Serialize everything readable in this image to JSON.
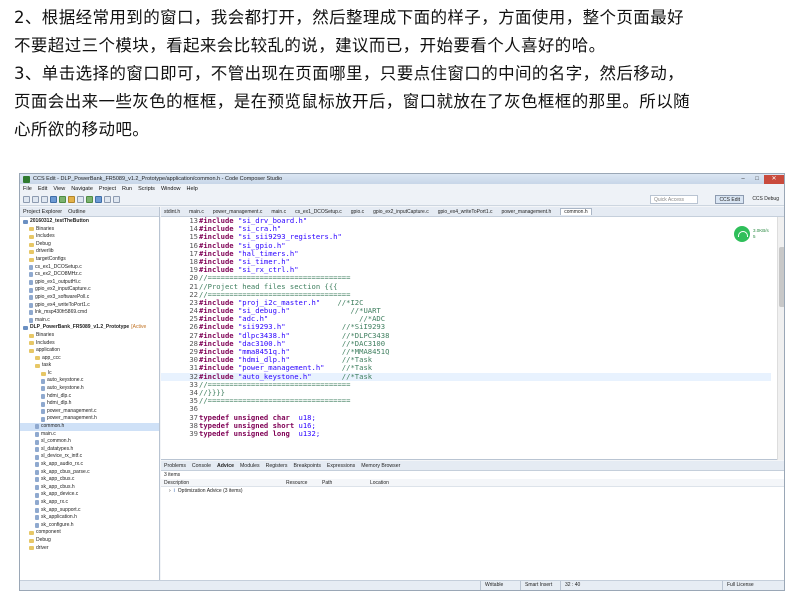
{
  "article": {
    "p1_line1": "2、根据经常用到的窗口，我会都打开，然后整理成下面的样子，方面使用，整个页面最好",
    "p1_line2": "不要超过三个模块，看起来会比较乱的说，建议而已，开始要看个人喜好的哈。",
    "p2_line1": "3、单击选择的窗口即可，不管出现在页面哪里，只要点住窗口的中间的名字，然后移动，",
    "p2_line2": "页面会出来一些灰色的框框，是在预览鼠标放开后，窗口就放在了灰色框框的那里。所以随",
    "p2_line3": "心所欲的移动吧。"
  },
  "ide": {
    "title": "CCS Edit - DLP_PowerBank_FR5089_v1.2_Prototype/application/common.h - Code Composer Studio",
    "menu": [
      "File",
      "Edit",
      "View",
      "Navigate",
      "Project",
      "Run",
      "Scripts",
      "Window",
      "Help"
    ],
    "quick_access": "Quick Access",
    "perspective_active": "CCS Edit",
    "perspective_other": "CCS Debug",
    "left_tabs": [
      "Project Explorer",
      "Outline"
    ],
    "tree": [
      {
        "indent": 0,
        "icon": "proj",
        "label": "20160312_testTheButton"
      },
      {
        "indent": 1,
        "icon": "folder",
        "label": "Binaries"
      },
      {
        "indent": 1,
        "icon": "folder",
        "label": "Includes"
      },
      {
        "indent": 1,
        "icon": "folder",
        "label": "Debug"
      },
      {
        "indent": 1,
        "icon": "folder",
        "label": "driverlib"
      },
      {
        "indent": 1,
        "icon": "folder",
        "label": "targetConfigs"
      },
      {
        "indent": 1,
        "icon": "file",
        "label": "cs_ex1_DCOSetup.c"
      },
      {
        "indent": 1,
        "icon": "file",
        "label": "cs_ex2_DCO8MHz.c"
      },
      {
        "indent": 1,
        "icon": "file",
        "label": "gpio_ex1_outputHi.c"
      },
      {
        "indent": 1,
        "icon": "file",
        "label": "gpio_ex2_inputCapture.c"
      },
      {
        "indent": 1,
        "icon": "file",
        "label": "gpio_ex3_softwarePoll.c"
      },
      {
        "indent": 1,
        "icon": "file",
        "label": "gpio_ex4_writeToPort1.c"
      },
      {
        "indent": 1,
        "icon": "file",
        "label": "lnk_msp430fr5869.cmd"
      },
      {
        "indent": 1,
        "icon": "file",
        "label": "main.c"
      },
      {
        "indent": 0,
        "icon": "proj",
        "label": "DLP_PowerBank_FR5089_v1.2_Prototype",
        "tag": "[Active"
      },
      {
        "indent": 1,
        "icon": "folder",
        "label": "Binaries"
      },
      {
        "indent": 1,
        "icon": "folder",
        "label": "Includes"
      },
      {
        "indent": 1,
        "icon": "folder",
        "label": "application"
      },
      {
        "indent": 2,
        "icon": "folder",
        "label": "app_ccc"
      },
      {
        "indent": 2,
        "icon": "folder",
        "label": "task"
      },
      {
        "indent": 3,
        "icon": "folder",
        "label": "lc"
      },
      {
        "indent": 3,
        "icon": "file",
        "label": "auto_keystone.c"
      },
      {
        "indent": 3,
        "icon": "file",
        "label": "auto_keystone.h"
      },
      {
        "indent": 3,
        "icon": "file",
        "label": "hdmi_dlp.c"
      },
      {
        "indent": 3,
        "icon": "file",
        "label": "hdmi_dlp.h"
      },
      {
        "indent": 3,
        "icon": "file",
        "label": "power_management.c"
      },
      {
        "indent": 3,
        "icon": "file",
        "label": "power_management.h"
      },
      {
        "indent": 2,
        "icon": "file",
        "label": "common.h",
        "selected": true
      },
      {
        "indent": 2,
        "icon": "file",
        "label": "main.c"
      },
      {
        "indent": 2,
        "icon": "file",
        "label": "sl_common.h"
      },
      {
        "indent": 2,
        "icon": "file",
        "label": "sl_datatypes.h"
      },
      {
        "indent": 2,
        "icon": "file",
        "label": "sl_device_rx_intf.c"
      },
      {
        "indent": 2,
        "icon": "file",
        "label": "sk_app_audio_rx.c"
      },
      {
        "indent": 2,
        "icon": "file",
        "label": "sk_app_cbus_parse.c"
      },
      {
        "indent": 2,
        "icon": "file",
        "label": "sk_app_cbus.c"
      },
      {
        "indent": 2,
        "icon": "file",
        "label": "sk_app_cbus.h"
      },
      {
        "indent": 2,
        "icon": "file",
        "label": "sk_app_device.c"
      },
      {
        "indent": 2,
        "icon": "file",
        "label": "sk_app_rx.c"
      },
      {
        "indent": 2,
        "icon": "file",
        "label": "sk_app_support.c"
      },
      {
        "indent": 2,
        "icon": "file",
        "label": "sk_application.h"
      },
      {
        "indent": 2,
        "icon": "file",
        "label": "sk_configure.h"
      },
      {
        "indent": 1,
        "icon": "folder",
        "label": "component"
      },
      {
        "indent": 1,
        "icon": "folder",
        "label": "Debug"
      },
      {
        "indent": 1,
        "icon": "folder",
        "label": "driver"
      }
    ],
    "editor_tabs": [
      {
        "label": "stdint.h",
        "active": false
      },
      {
        "label": "main.c",
        "active": false
      },
      {
        "label": "power_management.c",
        "active": false
      },
      {
        "label": "main.c",
        "active": false
      },
      {
        "label": "cs_ex1_DCOSetup.c",
        "active": false
      },
      {
        "label": "gpio.c",
        "active": false
      },
      {
        "label": "gpio_ex2_inputCapture.c",
        "active": false
      },
      {
        "label": "gpio_ex4_writeToPort1.c",
        "active": false
      },
      {
        "label": "power_management.h",
        "active": false
      },
      {
        "label": "common.h",
        "active": true
      }
    ],
    "code_lines": [
      {
        "n": "13",
        "kw": "#include",
        "str": " \"si_drv_board.h\"",
        "com": ""
      },
      {
        "n": "14",
        "kw": "#include",
        "str": " \"si_cra.h\"",
        "com": ""
      },
      {
        "n": "15",
        "kw": "#include",
        "str": " \"si_sii9293_registers.h\"",
        "com": ""
      },
      {
        "n": "16",
        "kw": "#include",
        "str": " \"si_gpio.h\"",
        "com": ""
      },
      {
        "n": "17",
        "kw": "#include",
        "str": " \"hal_timers.h\"",
        "com": ""
      },
      {
        "n": "18",
        "kw": "#include",
        "str": " \"si_timer.h\"",
        "com": ""
      },
      {
        "n": "19",
        "kw": "#include",
        "str": " \"si_rx_ctrl.h\"",
        "com": ""
      },
      {
        "n": "20",
        "kw": "",
        "str": "",
        "com": "//================================="
      },
      {
        "n": "21",
        "kw": "",
        "str": "",
        "com": "//Project head files section {{{"
      },
      {
        "n": "22",
        "kw": "",
        "str": "",
        "com": "//================================="
      },
      {
        "n": "23",
        "kw": "#include",
        "str": " \"proj_i2c_master.h\"",
        "com": "    //*I2C"
      },
      {
        "n": "24",
        "kw": "#include",
        "str": " \"si_debug.h\"",
        "com": "              //*UART"
      },
      {
        "n": "25",
        "kw": "#include",
        "str": " \"adc.h\"",
        "com": "                     //*ADC"
      },
      {
        "n": "26",
        "kw": "#include",
        "str": " \"sii9293.h\"",
        "com": "             //*SiI9293"
      },
      {
        "n": "27",
        "kw": "#include",
        "str": " \"dlpc3438.h\"",
        "com": "            //*DLPC3438"
      },
      {
        "n": "28",
        "kw": "#include",
        "str": " \"dac3100.h\"",
        "com": "             //*DAC3100"
      },
      {
        "n": "29",
        "kw": "#include",
        "str": " \"mma8451q.h\"",
        "com": "            //*MMA8451Q"
      },
      {
        "n": "30",
        "kw": "#include",
        "str": " \"hdmi_dlp.h\"",
        "com": "            //*Task"
      },
      {
        "n": "31",
        "kw": "#include",
        "str": " \"power_management.h\"",
        "com": "    //*Task"
      },
      {
        "n": "32",
        "kw": "#include",
        "str": " \"auto_keystone.h\"",
        "com": "       //*Task",
        "current": true
      },
      {
        "n": "33",
        "kw": "",
        "str": "",
        "com": "//================================="
      },
      {
        "n": "34",
        "kw": "",
        "str": "",
        "com": "//}}}}"
      },
      {
        "n": "35",
        "kw": "",
        "str": "",
        "com": "//================================="
      },
      {
        "n": "36",
        "kw": "",
        "str": "",
        "com": ""
      },
      {
        "n": "37",
        "kw": "typedef unsigned char",
        "str": "  u18;",
        "com": ""
      },
      {
        "n": "38",
        "kw": "typedef unsigned short",
        "str": " u16;",
        "com": ""
      },
      {
        "n": "39",
        "kw": "typedef unsigned long",
        "str": "  u132;",
        "com": ""
      }
    ],
    "network": {
      "up": "3.0KB/s",
      "down": "5"
    },
    "bottom_tabs": [
      {
        "label": "Problems",
        "active": false
      },
      {
        "label": "Console",
        "active": false
      },
      {
        "label": "Advice",
        "active": true
      },
      {
        "label": "Modules",
        "active": false
      },
      {
        "label": "Registers",
        "active": false
      },
      {
        "label": "Breakpoints",
        "active": false
      },
      {
        "label": "Expressions",
        "active": false
      },
      {
        "label": "Memory Browser",
        "active": false
      }
    ],
    "advice_items": "3 items",
    "advice_columns": [
      "Description",
      "Resource",
      "Path",
      "Location"
    ],
    "advice_row": "Optimization Advice (3 items)",
    "status": {
      "writable": "Writable",
      "insert": "Smart Insert",
      "position": "32 : 40",
      "license": "Full License"
    }
  }
}
